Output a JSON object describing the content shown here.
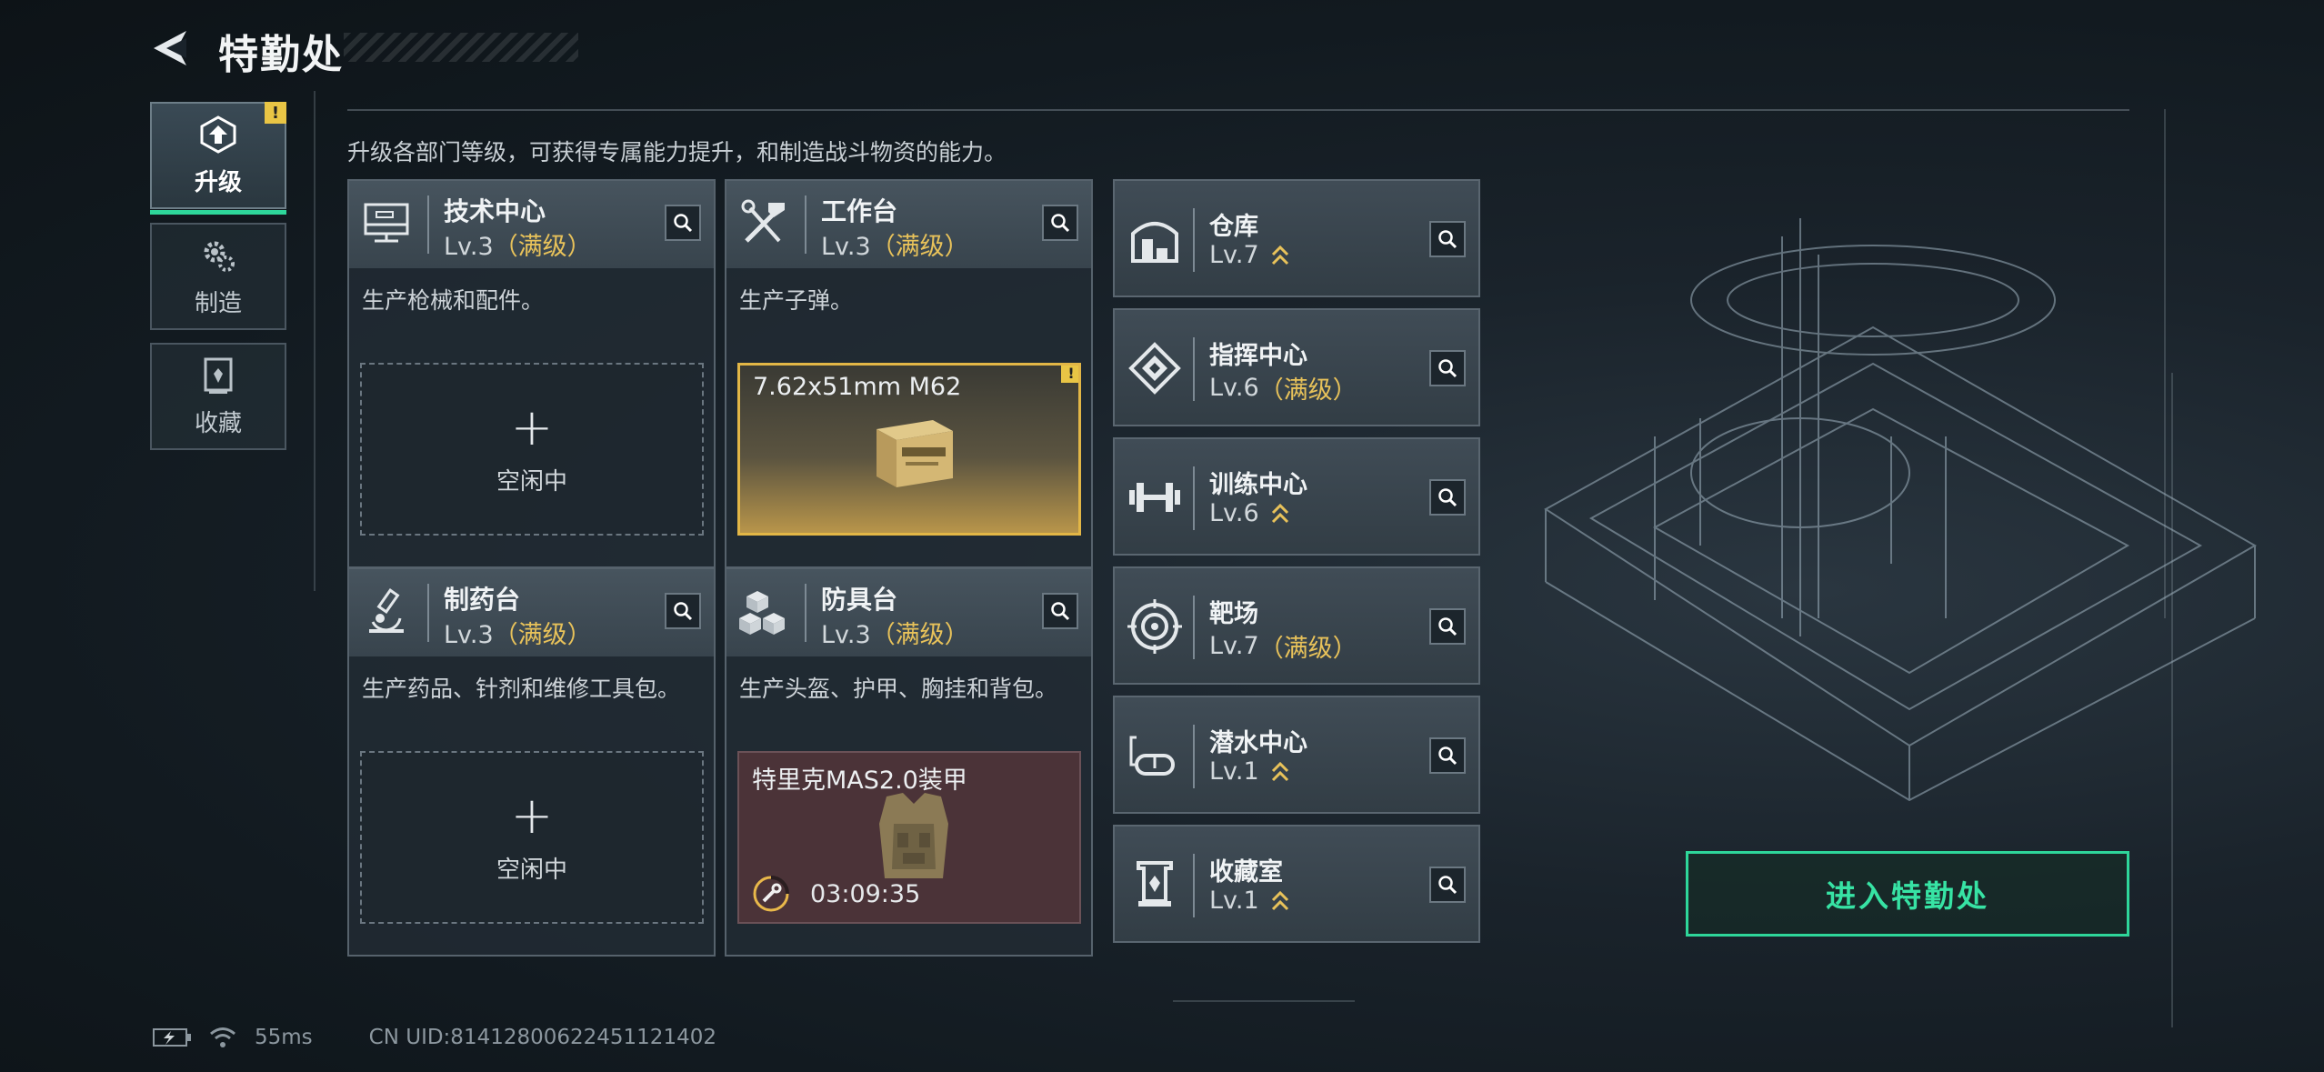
{
  "header": {
    "title": "特勤处"
  },
  "nav": [
    {
      "label": "升级",
      "icon": "upgrade-icon",
      "active": true,
      "warning": "!"
    },
    {
      "label": "制造",
      "icon": "gear-icon",
      "active": false
    },
    {
      "label": "收藏",
      "icon": "collection-icon",
      "active": false
    }
  ],
  "description": "升级各部门等级，可获得专属能力提升，和制造战斗物资的能力。",
  "cards": [
    {
      "name": "技术中心",
      "level": "Lv.3",
      "maxed": "（满级）",
      "desc": "生产枪械和配件。",
      "icon": "computer-icon",
      "slot": {
        "plus": "+",
        "status": "空闲中"
      }
    },
    {
      "name": "工作台",
      "level": "Lv.3",
      "maxed": "（满级）",
      "desc": "生产子弹。",
      "icon": "tools-icon",
      "slot": {
        "title": "7.62x51mm M62",
        "warning": "!"
      }
    },
    {
      "name": "制药台",
      "level": "Lv.3",
      "maxed": "（满级）",
      "desc": "生产药品、针剂和维修工具包。",
      "icon": "microscope-icon",
      "slot": {
        "plus": "+",
        "status": "空闲中"
      }
    },
    {
      "name": "防具台",
      "level": "Lv.3",
      "maxed": "（满级）",
      "desc": "生产头盔、护甲、胸挂和背包。",
      "icon": "cubes-icon",
      "slot": {
        "title": "特里克MAS2.0装甲",
        "timer": "03:09:35"
      }
    }
  ],
  "rooms": [
    {
      "name": "仓库",
      "level": "Lv.7",
      "maxed": "",
      "upgradable": true,
      "icon": "warehouse-icon"
    },
    {
      "name": "指挥中心",
      "level": "Lv.6",
      "maxed": "（满级）",
      "upgradable": false,
      "icon": "command-icon"
    },
    {
      "name": "训练中心",
      "level": "Lv.6",
      "maxed": "",
      "upgradable": true,
      "icon": "dumbbell-icon"
    },
    {
      "name": "靶场",
      "level": "Lv.7",
      "maxed": "（满级）",
      "upgradable": false,
      "icon": "target-icon"
    },
    {
      "name": "潜水中心",
      "level": "Lv.1",
      "maxed": "",
      "upgradable": true,
      "icon": "diving-mask-icon"
    },
    {
      "name": "收藏室",
      "level": "Lv.1",
      "maxed": "",
      "upgradable": true,
      "icon": "collection-room-icon"
    }
  ],
  "enter_button": "进入特勤处",
  "status": {
    "ping": "55ms",
    "uid": "CN UID:814128006224511214​02"
  },
  "colors": {
    "accent": "#2ed69a",
    "gold": "#e8c25a",
    "warning": "#e9c545",
    "armor_slot": "#4b3338"
  }
}
